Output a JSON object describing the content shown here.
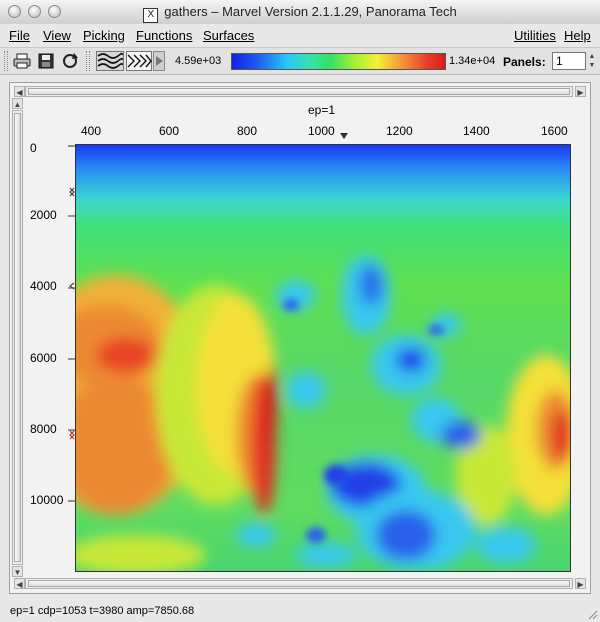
{
  "window": {
    "title": "gathers – Marvel Version 2.1.1.29, Panorama Tech",
    "title_icon": "X"
  },
  "menus": {
    "left": [
      "File",
      "View",
      "Picking",
      "Functions",
      "Surfaces"
    ],
    "right": [
      "Utilities",
      "Help"
    ]
  },
  "toolbar": {
    "icons": [
      "print-icon",
      "save-icon",
      "refresh-icon",
      "wiggle-display-icon",
      "variable-density-icon",
      "play-arrow-icon"
    ],
    "colorbar_min": "4.59e+03",
    "colorbar_max": "1.34e+04",
    "panels_label": "Panels:",
    "panels_value": "1",
    "colorbar_colors": [
      "#1022e6",
      "#28c8f8",
      "#34e064",
      "#f4f038",
      "#f49438",
      "#d81e1a"
    ]
  },
  "plot": {
    "header": "ep=1",
    "x_ticks": [
      "400",
      "600",
      "800",
      "1000",
      "1200",
      "1400",
      "1600"
    ],
    "y_ticks": [
      "0",
      "2000",
      "4000",
      "6000",
      "8000",
      "10000"
    ]
  },
  "status": {
    "text": "ep=1  cdp=1053 t=3980 amp=7850.68"
  }
}
